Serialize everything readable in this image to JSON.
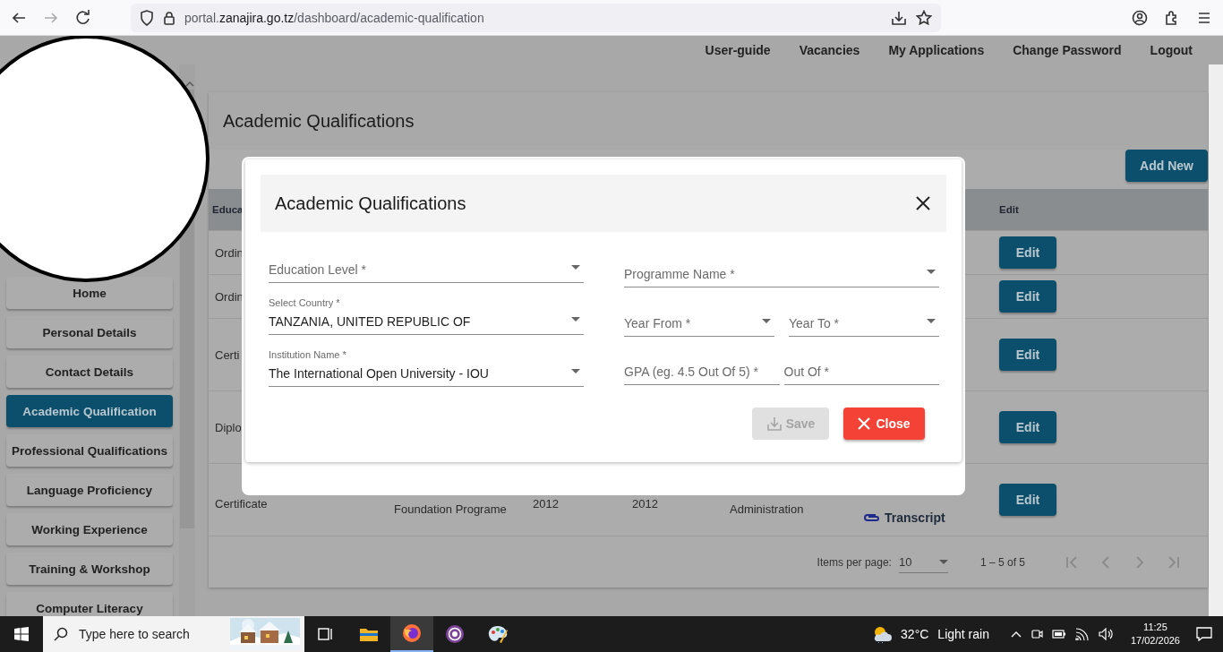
{
  "browser": {
    "url_prefix": "portal.",
    "url_domain": "zanajira.go.tz",
    "url_path": "/dashboard/academic-qualification"
  },
  "nav": [
    "User-guide",
    "Vacancies",
    "My Applications",
    "Change Password",
    "Logout"
  ],
  "sidebar": {
    "items": [
      {
        "label": "Home",
        "selected": false
      },
      {
        "label": "Personal Details",
        "selected": false
      },
      {
        "label": "Contact Details",
        "selected": false
      },
      {
        "label": "Academic Qualification",
        "selected": true
      },
      {
        "label": "Professional Qualifications",
        "selected": false
      },
      {
        "label": "Language Proficiency",
        "selected": false
      },
      {
        "label": "Working Experience",
        "selected": false
      },
      {
        "label": "Training & Workshop",
        "selected": false
      },
      {
        "label": "Computer Literacy",
        "selected": false
      }
    ]
  },
  "page_title": "Academic Qualifications",
  "add_button": "Add New",
  "table": {
    "columns": [
      "Educa",
      "Edit"
    ],
    "rows": [
      {
        "column_1": "Ordin",
        "edit": "Edit"
      },
      {
        "column_1": "Ordin",
        "edit": "Edit"
      },
      {
        "column_1": "Certi",
        "edit": "Edit"
      },
      {
        "column_1": "Diplo",
        "edit": "Edit"
      },
      {
        "column_1": "Certificate",
        "column_2": "Foundation Programe",
        "column_3": "2012",
        "column_4": "2012",
        "column_5": "Administration",
        "attachment": "Transcript",
        "edit": "Edit"
      }
    ]
  },
  "paginator": {
    "label": "Items per page:",
    "page_size": "10",
    "range": "1 – 5 of 5"
  },
  "modal": {
    "title": "Academic Qualifications",
    "left_fields": [
      {
        "kind": "select",
        "label": "Education Level *"
      },
      {
        "kind": "select",
        "label": "Select Country *",
        "value": "TANZANIA, UNITED REPUBLIC OF"
      },
      {
        "kind": "select",
        "label": "Institution Name *",
        "value": "The International Open University - IOU"
      }
    ],
    "right_rows": [
      [
        {
          "kind": "select",
          "label": "Programme Name *"
        }
      ],
      [
        {
          "kind": "select",
          "label": "Year From *"
        },
        {
          "kind": "select",
          "label": "Year To *"
        }
      ],
      [
        {
          "kind": "input",
          "label": "GPA (eg. 4.5 Out Of 5) *"
        },
        {
          "kind": "input",
          "label": "Out Of *"
        }
      ]
    ],
    "buttons": [
      {
        "kind": "save",
        "label": "Save",
        "disabled": true
      },
      {
        "kind": "close",
        "label": "Close",
        "disabled": false
      }
    ]
  },
  "taskbar": {
    "search_placeholder": "Type here to search",
    "apps": [
      {
        "kind": "taskview",
        "selected": false
      },
      {
        "kind": "explorer",
        "selected": false
      },
      {
        "kind": "firefox",
        "selected": true
      },
      {
        "kind": "tor",
        "selected": false
      },
      {
        "kind": "paint",
        "selected": false
      }
    ],
    "temperature": "32°C",
    "condition": "Light rain",
    "time": "11:25",
    "date": "17/02/2026"
  }
}
